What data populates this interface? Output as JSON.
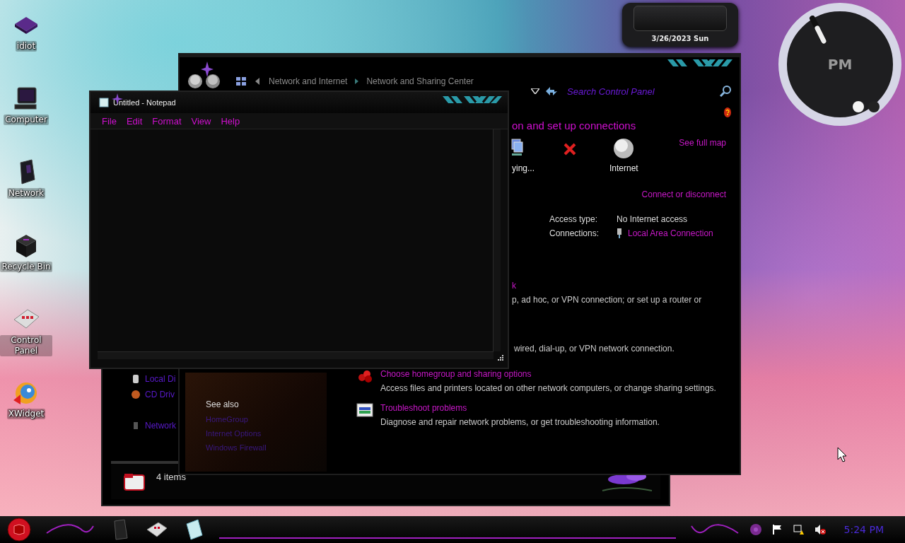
{
  "desktop_icons": [
    {
      "label": "idiot",
      "kind": "disk"
    },
    {
      "label": "Computer",
      "kind": "computer"
    },
    {
      "label": "Network",
      "kind": "network"
    },
    {
      "label": "Recycle Bin",
      "kind": "bin"
    },
    {
      "label": "Control Panel",
      "kind": "panel"
    },
    {
      "label": "XWidget",
      "kind": "widget"
    }
  ],
  "date_widget": {
    "date": "3/26/2023 Sun"
  },
  "clock_widget": {
    "period": "PM"
  },
  "explorer_window": {
    "sidebar_items": [
      {
        "label": "Local Di",
        "kind": "drive"
      },
      {
        "label": "CD Driv",
        "kind": "cd"
      },
      {
        "label": "Network",
        "kind": "network"
      }
    ],
    "status": "4 items"
  },
  "control_panel": {
    "breadcrumb": [
      "Network and Internet",
      "Network and Sharing Center"
    ],
    "search": {
      "placeholder": "Search Control Panel"
    },
    "heading": "on and set up connections",
    "see_full_map": "See full map",
    "map": {
      "this_pc": "ying...",
      "link_broken": true,
      "internet": "Internet"
    },
    "connect_link": "Connect or disconnect",
    "properties": [
      {
        "label": "Access type:",
        "value": "No Internet access",
        "kind": "text"
      },
      {
        "label": "Connections:",
        "value": "Local Area Connection",
        "kind": "link"
      }
    ],
    "settings_fragments": [
      {
        "title": "k",
        "description": "p, ad hoc, or VPN connection; or set up a router or"
      },
      {
        "description": "wired, dial-up, or VPN network connection."
      }
    ],
    "tasks": [
      {
        "title": "Choose homegroup and sharing options",
        "description": "Access files and printers located on other network computers, or change sharing settings.",
        "kind": "homegroup"
      },
      {
        "title": "Troubleshoot problems",
        "description": "Diagnose and repair network problems, or get troubleshooting information.",
        "kind": "troubleshoot"
      }
    ],
    "see_also": {
      "heading": "See also",
      "links": [
        "HomeGroup",
        "Internet Options",
        "Windows Firewall"
      ]
    }
  },
  "notepad": {
    "title": "Untitled - Notepad",
    "menu": [
      "File",
      "Edit",
      "Format",
      "View",
      "Help"
    ]
  },
  "taskbar": {
    "pinned": [
      {
        "kind": "explorer"
      },
      {
        "kind": "control-panel"
      },
      {
        "kind": "notepad"
      }
    ],
    "time": "5:24 PM"
  }
}
